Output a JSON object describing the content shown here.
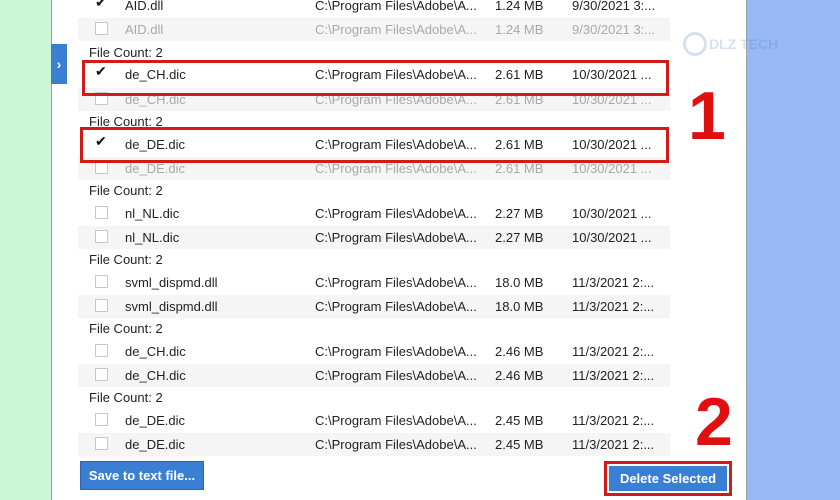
{
  "colors": {
    "accent": "#3b7fd4",
    "highlight": "#d11a1a"
  },
  "panel": {
    "rows": [
      {
        "kind": "file",
        "checked": true,
        "greyed": false,
        "name": "AID.dll",
        "path": "C:\\Program Files\\Adobe\\A...",
        "size": "1.24 MB",
        "date": "9/30/2021 3:..."
      },
      {
        "kind": "file",
        "checked": false,
        "greyed": true,
        "name": "AID.dll",
        "path": "C:\\Program Files\\Adobe\\A...",
        "size": "1.24 MB",
        "date": "9/30/2021 3:..."
      },
      {
        "kind": "group",
        "text": "File Count: 2"
      },
      {
        "kind": "file",
        "checked": true,
        "greyed": false,
        "name": "de_CH.dic",
        "path": "C:\\Program Files\\Adobe\\A...",
        "size": "2.61 MB",
        "date": "10/30/2021 ..."
      },
      {
        "kind": "file",
        "checked": false,
        "greyed": true,
        "name": "de_CH.dic",
        "path": "C:\\Program Files\\Adobe\\A...",
        "size": "2.61 MB",
        "date": "10/30/2021 ..."
      },
      {
        "kind": "group",
        "text": "File Count: 2"
      },
      {
        "kind": "file",
        "checked": true,
        "greyed": false,
        "name": "de_DE.dic",
        "path": "C:\\Program Files\\Adobe\\A...",
        "size": "2.61 MB",
        "date": "10/30/2021 ..."
      },
      {
        "kind": "file",
        "checked": false,
        "greyed": true,
        "name": "de_DE.dic",
        "path": "C:\\Program Files\\Adobe\\A...",
        "size": "2.61 MB",
        "date": "10/30/2021 ..."
      },
      {
        "kind": "group",
        "text": "File Count: 2"
      },
      {
        "kind": "file",
        "checked": false,
        "greyed": false,
        "name": "nl_NL.dic",
        "path": "C:\\Program Files\\Adobe\\A...",
        "size": "2.27 MB",
        "date": "10/30/2021 ..."
      },
      {
        "kind": "file",
        "checked": false,
        "greyed": false,
        "name": "nl_NL.dic",
        "path": "C:\\Program Files\\Adobe\\A...",
        "size": "2.27 MB",
        "date": "10/30/2021 ..."
      },
      {
        "kind": "group",
        "text": "File Count: 2"
      },
      {
        "kind": "file",
        "checked": false,
        "greyed": false,
        "name": "svml_dispmd.dll",
        "path": "C:\\Program Files\\Adobe\\A...",
        "size": "18.0 MB",
        "date": "11/3/2021 2:..."
      },
      {
        "kind": "file",
        "checked": false,
        "greyed": false,
        "name": "svml_dispmd.dll",
        "path": "C:\\Program Files\\Adobe\\A...",
        "size": "18.0 MB",
        "date": "11/3/2021 2:..."
      },
      {
        "kind": "group",
        "text": "File Count: 2"
      },
      {
        "kind": "file",
        "checked": false,
        "greyed": false,
        "name": "de_CH.dic",
        "path": "C:\\Program Files\\Adobe\\A...",
        "size": "2.46 MB",
        "date": "11/3/2021 2:..."
      },
      {
        "kind": "file",
        "checked": false,
        "greyed": false,
        "name": "de_CH.dic",
        "path": "C:\\Program Files\\Adobe\\A...",
        "size": "2.46 MB",
        "date": "11/3/2021 2:..."
      },
      {
        "kind": "group",
        "text": "File Count: 2"
      },
      {
        "kind": "file",
        "checked": false,
        "greyed": false,
        "name": "de_DE.dic",
        "path": "C:\\Program Files\\Adobe\\A...",
        "size": "2.45 MB",
        "date": "11/3/2021 2:..."
      },
      {
        "kind": "file",
        "checked": false,
        "greyed": false,
        "name": "de_DE.dic",
        "path": "C:\\Program Files\\Adobe\\A...",
        "size": "2.45 MB",
        "date": "11/3/2021 2:..."
      }
    ]
  },
  "buttons": {
    "save_label": "Save to text file...",
    "delete_label": "Delete Selected"
  },
  "annotations": {
    "step1": "1",
    "step2": "2"
  },
  "watermark": {
    "text": "DLZ TECH"
  },
  "icons": {
    "expand": "chevron-right-icon",
    "check": "checkmark-icon"
  }
}
